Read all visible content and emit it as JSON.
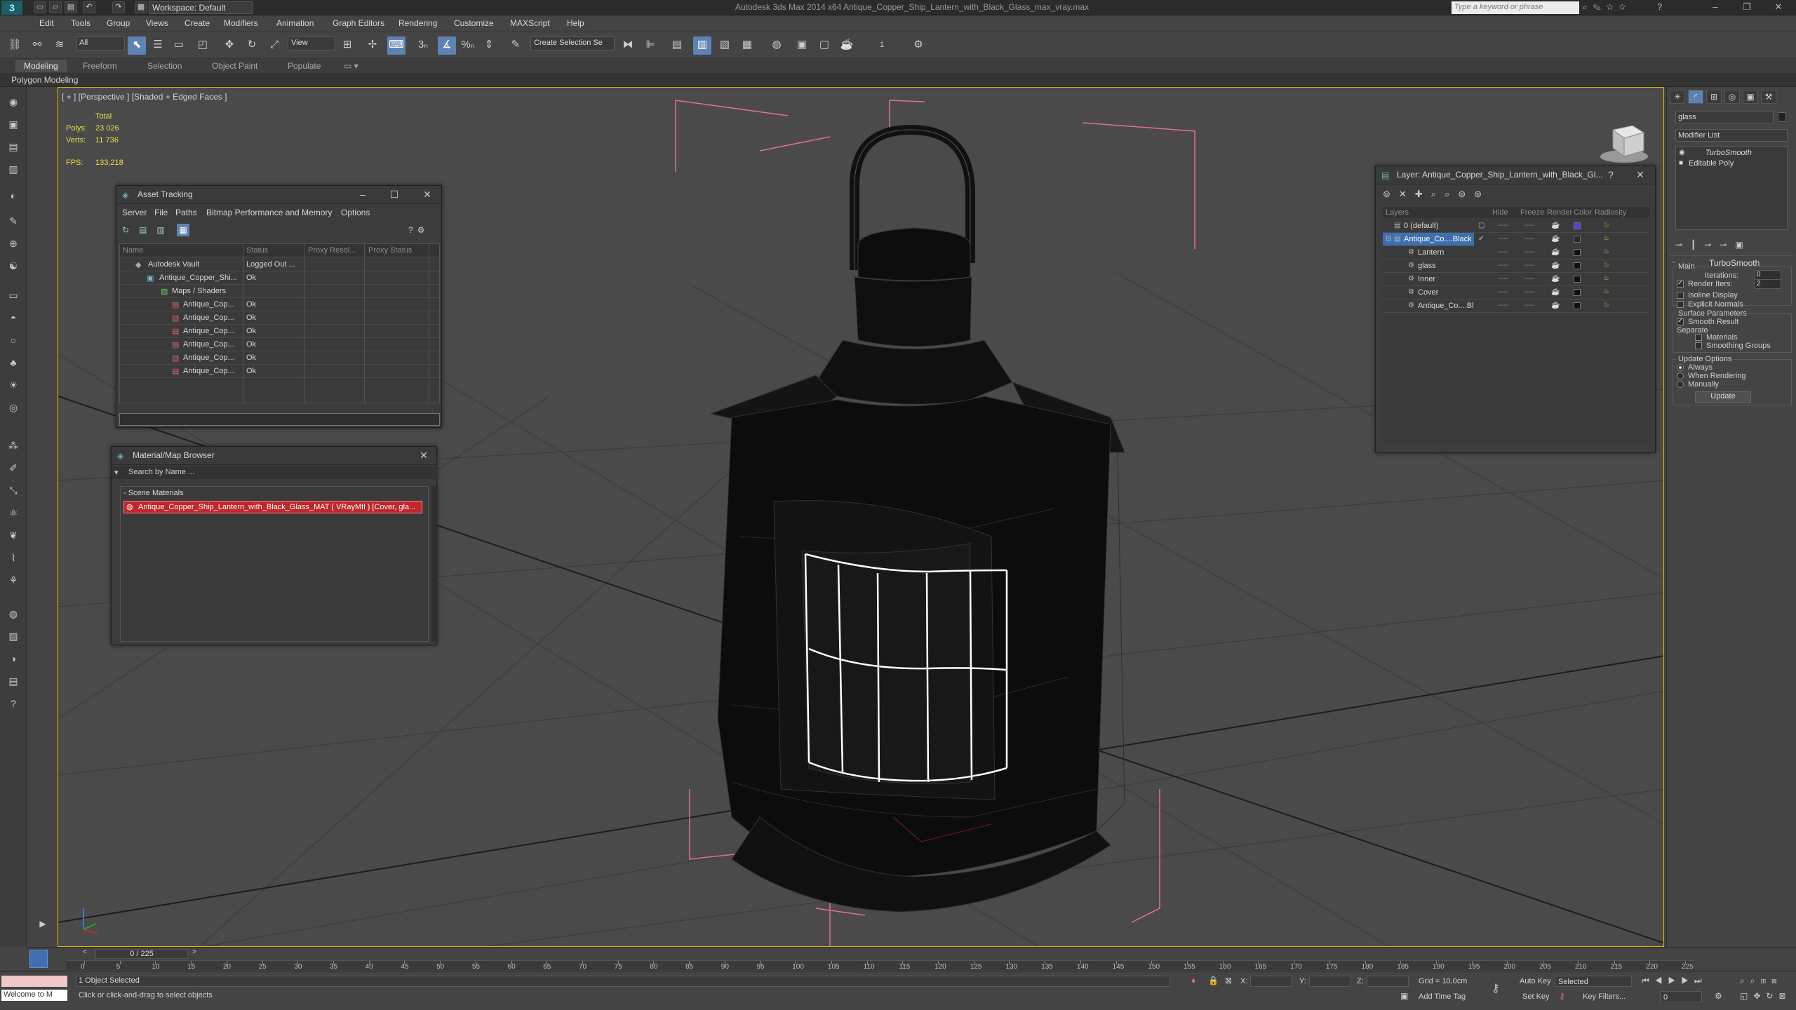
{
  "titlebar": {
    "workspace": "Workspace: Default",
    "title": "Autodesk 3ds Max  2014 x64     Antique_Copper_Ship_Lantern_with_Black_Glass_max_vray.max",
    "search_placeholder": "Type a keyword or phrase"
  },
  "menu": [
    "Edit",
    "Tools",
    "Group",
    "Views",
    "Create",
    "Modifiers",
    "Animation",
    "Graph Editors",
    "Rendering",
    "Customize",
    "MAXScript",
    "Help"
  ],
  "toolbar": {
    "filter": "All",
    "ref_coord": "View",
    "selection_set": "Create Selection Se",
    "snap_counter": "1"
  },
  "ribbon": {
    "tabs": [
      "Modeling",
      "Freeform",
      "Selection",
      "Object Paint",
      "Populate"
    ],
    "subtab": "Polygon Modeling"
  },
  "viewport": {
    "label": "[ + ] [Perspective ] [Shaded + Edged Faces ]",
    "stats": {
      "total_label": "Total",
      "polys_label": "Polys:",
      "polys": "23 026",
      "verts_label": "Verts:",
      "verts": "11 736",
      "fps_label": "FPS:",
      "fps": "133,218"
    }
  },
  "asset_tracking": {
    "title": "Asset Tracking",
    "menu": [
      "Server",
      "File",
      "Paths",
      "Bitmap Performance and Memory",
      "Options"
    ],
    "columns": [
      "Name",
      "Status",
      "Proxy Resol...",
      "Proxy Status"
    ],
    "rows": [
      {
        "name": "Autodesk Vault",
        "status": "Logged Out ..."
      },
      {
        "name": "Antique_Copper_Shi...",
        "status": "Ok"
      },
      {
        "name": "Maps / Shaders",
        "status": ""
      },
      {
        "name": "Antique_Cop...",
        "status": "Ok"
      },
      {
        "name": "Antique_Cop...",
        "status": "Ok"
      },
      {
        "name": "Antique_Cop...",
        "status": "Ok"
      },
      {
        "name": "Antique_Cop...",
        "status": "Ok"
      },
      {
        "name": "Antique_Cop...",
        "status": "Ok"
      },
      {
        "name": "Antique_Cop...",
        "status": "Ok"
      }
    ]
  },
  "material_browser": {
    "title": "Material/Map Browser",
    "search_placeholder": "Search by Name ...",
    "section": "- Scene Materials",
    "item": "Antique_Copper_Ship_Lantern_with_Black_Glass_MAT ( VRayMtl ) [Cover, gla..."
  },
  "layer_dialog": {
    "title": "Layer: Antique_Copper_Ship_Lantern_with_Black_Gl...",
    "help": "?",
    "columns": [
      "Layers",
      "Hide",
      "Freeze",
      "Render",
      "Color",
      "Radiosity"
    ],
    "rows": [
      {
        "name": "0 (default)",
        "color": "#5a3fd8"
      },
      {
        "name": "Antique_Co....Black",
        "color": "#2a2a2a"
      },
      {
        "name": "Lantern",
        "color": "#111111"
      },
      {
        "name": "glass",
        "color": "#111111"
      },
      {
        "name": "Inner",
        "color": "#111111"
      },
      {
        "name": "Cover",
        "color": "#111111"
      },
      {
        "name": "Antique_Co....Bl",
        "color": "#111111"
      }
    ],
    "dash": "----"
  },
  "command_panel": {
    "object_name": "glass",
    "modifier_list": "Modifier List",
    "stack": [
      "TurboSmooth",
      "Editable Poly"
    ],
    "turbosmooth": {
      "title": "TurboSmooth",
      "main": "Main",
      "iterations_label": "Iterations:",
      "iterations": "0",
      "render_iters_label": "Render Iters:",
      "render_iters": "2",
      "isoline": "Isoline Display",
      "explicit": "Explicit Normals",
      "surface_params": "Surface Parameters",
      "smooth_result": "Smooth Result",
      "separate": "Separate",
      "materials": "Materials",
      "smoothing_groups": "Smoothing Groups",
      "update_options": "Update Options",
      "always": "Always",
      "when_rendering": "When Rendering",
      "manually": "Manually",
      "update_btn": "Update"
    }
  },
  "timeline": {
    "frame_display": "0 / 225",
    "ticks": [
      "0",
      "5",
      "10",
      "15",
      "20",
      "25",
      "30",
      "35",
      "40",
      "45",
      "50",
      "55",
      "60",
      "65",
      "70",
      "75",
      "80",
      "85",
      "90",
      "95",
      "100",
      "105",
      "110",
      "115",
      "120",
      "125",
      "130",
      "135",
      "140",
      "145",
      "150",
      "155",
      "160",
      "165",
      "170",
      "175",
      "180",
      "185",
      "190",
      "195",
      "200",
      "205",
      "210",
      "215",
      "220",
      "225"
    ]
  },
  "status": {
    "maxscript": "Welcome to M",
    "selected": "1 Object Selected",
    "prompt": "Click or click-and-drag to select objects",
    "x_label": "X:",
    "y_label": "Y:",
    "z_label": "Z:",
    "grid": "Grid = 10,0cm",
    "add_time_tag": "Add Time Tag",
    "auto_key": "Auto Key",
    "set_key": "Set Key",
    "selected_dd": "Selected",
    "key_filters": "Key Filters...",
    "frame": "0"
  }
}
